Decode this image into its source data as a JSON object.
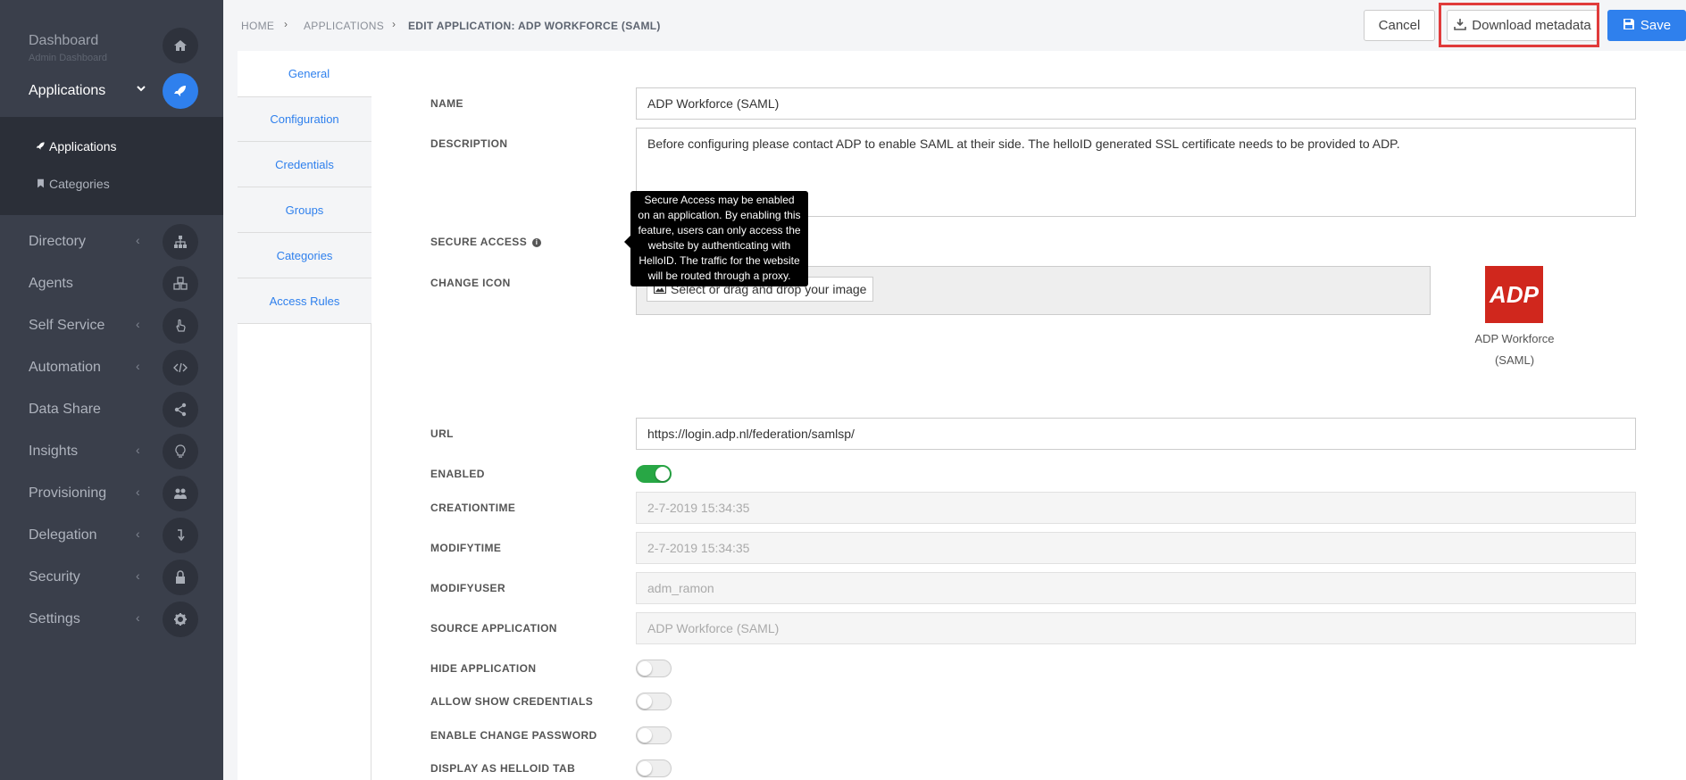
{
  "sidebar": {
    "dashboard": {
      "label": "Dashboard",
      "sub": "Admin Dashboard",
      "icon": "home-icon"
    },
    "applications": {
      "label": "Applications",
      "icon": "rocket-icon"
    },
    "submenu": [
      {
        "label": "Applications",
        "icon": "rocket-icon"
      },
      {
        "label": "Categories",
        "icon": "bookmark-icon"
      }
    ],
    "items": [
      {
        "label": "Directory",
        "icon": "sitemap-icon"
      },
      {
        "label": "Agents",
        "icon": "cubes-icon"
      },
      {
        "label": "Self Service",
        "icon": "hand-pointer-icon"
      },
      {
        "label": "Automation",
        "icon": "code-icon"
      },
      {
        "label": "Data Share",
        "icon": "share-icon"
      },
      {
        "label": "Insights",
        "icon": "lightbulb-icon"
      },
      {
        "label": "Provisioning",
        "icon": "users-icon"
      },
      {
        "label": "Delegation",
        "icon": "level-down-icon"
      },
      {
        "label": "Security",
        "icon": "lock-icon"
      },
      {
        "label": "Settings",
        "icon": "gear-icon"
      }
    ]
  },
  "breadcrumb": {
    "home": "HOME",
    "applications": "APPLICATIONS",
    "current": "EDIT APPLICATION: ADP WORKFORCE (SAML)"
  },
  "toolbar": {
    "cancel_label": "Cancel",
    "download_label": "Download metadata",
    "save_label": "Save"
  },
  "tabs": [
    "General",
    "Configuration",
    "Credentials",
    "Groups",
    "Categories",
    "Access Rules"
  ],
  "form": {
    "name": {
      "label": "NAME",
      "value": "ADP Workforce (SAML)"
    },
    "description": {
      "label": "DESCRIPTION",
      "value": "Before configuring please contact ADP to enable SAML at their side. The helloID generated SSL certificate needs to be provided to ADP."
    },
    "secure_access": {
      "label": "SECURE ACCESS"
    },
    "change_icon": {
      "label": "CHANGE ICON",
      "button": "Select or drag and drop your image"
    },
    "icon_preview": {
      "logo_text": "ADP",
      "caption_line1": "ADP Workforce",
      "caption_line2": "(SAML)"
    },
    "url": {
      "label": "URL",
      "value": "https://login.adp.nl/federation/samlsp/"
    },
    "enabled": {
      "label": "ENABLED",
      "value": true
    },
    "creationtime": {
      "label": "CREATIONTIME",
      "value": "2-7-2019 15:34:35"
    },
    "modifytime": {
      "label": "MODIFYTIME",
      "value": "2-7-2019 15:34:35"
    },
    "modifyuser": {
      "label": "MODIFYUSER",
      "value": "adm_ramon"
    },
    "source_application": {
      "label": "SOURCE APPLICATION",
      "value": "ADP Workforce (SAML)"
    },
    "hide_application": {
      "label": "HIDE APPLICATION",
      "value": false
    },
    "allow_show_credentials": {
      "label": "ALLOW SHOW CREDENTIALS",
      "value": false
    },
    "enable_change_password": {
      "label": "ENABLE CHANGE PASSWORD",
      "value": false
    },
    "display_as_helloid_tab": {
      "label": "DISPLAY AS HELLOID TAB",
      "value": false
    }
  },
  "tooltip": {
    "lines": [
      "Secure Access may be enabled",
      "on an application. By enabling this",
      "feature, users can only access the",
      "website by authenticating with",
      "HelloID. The traffic for the website",
      "will be routed through a proxy."
    ]
  },
  "colors": {
    "accent": "#2f80ed",
    "sidebar_bg": "#3a3f4b",
    "toggle_on": "#28a745",
    "highlight": "#e03b3b",
    "adp_red": "#d0271d"
  }
}
